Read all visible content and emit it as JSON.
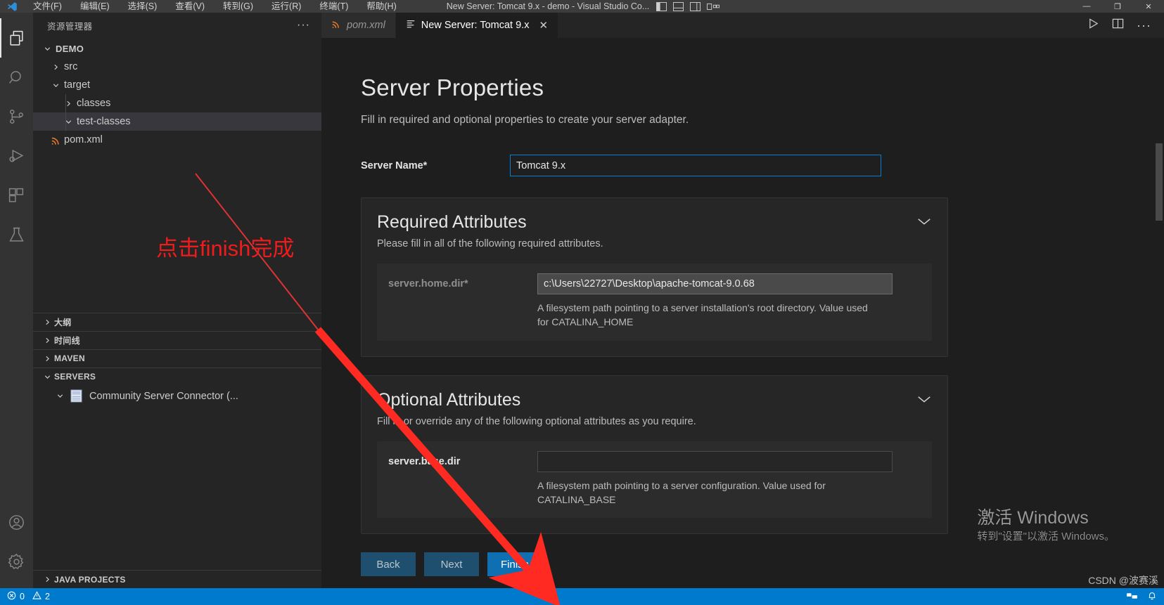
{
  "titlebar": {
    "menus": [
      "文件(F)",
      "编辑(E)",
      "选择(S)",
      "查看(V)",
      "转到(G)",
      "运行(R)",
      "终端(T)",
      "帮助(H)"
    ],
    "window_title": "New Server: Tomcat 9.x - demo - Visual Studio Co...",
    "layout_icons": [
      "panel-left-icon",
      "panel-bottom-icon",
      "panel-right-icon",
      "customize-layout-icon"
    ],
    "window_controls": [
      "minimize-icon",
      "maximize-icon",
      "close-icon"
    ]
  },
  "activitybar": {
    "items": [
      {
        "name": "explorer-icon",
        "active": true
      },
      {
        "name": "search-icon",
        "active": false
      },
      {
        "name": "source-control-icon",
        "active": false
      },
      {
        "name": "run-and-debug-icon",
        "active": false
      },
      {
        "name": "extensions-icon",
        "active": false
      },
      {
        "name": "testing-icon",
        "active": false
      }
    ],
    "bottom_items": [
      {
        "name": "accounts-icon"
      },
      {
        "name": "settings-gear-icon"
      }
    ]
  },
  "sidebar": {
    "title": "资源管理器",
    "more_actions": "···",
    "tree": [
      {
        "label": "DEMO",
        "level": 0,
        "expanded": true,
        "icon": "chevron-down-icon",
        "root": true,
        "selected": false
      },
      {
        "label": "src",
        "level": 1,
        "expanded": false,
        "icon": "chevron-right-icon",
        "root": false,
        "selected": false
      },
      {
        "label": "target",
        "level": 1,
        "expanded": true,
        "icon": "chevron-down-icon",
        "root": false,
        "selected": false
      },
      {
        "label": "classes",
        "level": 2,
        "expanded": false,
        "icon": "chevron-right-icon",
        "root": false,
        "selected": false
      },
      {
        "label": "test-classes",
        "level": 2,
        "expanded": true,
        "icon": "chevron-down-icon",
        "root": false,
        "selected": true
      },
      {
        "label": "pom.xml",
        "level": 1,
        "expanded": null,
        "icon": "xml-file-icon",
        "root": false,
        "selected": false
      }
    ],
    "sections": [
      {
        "label": "大纲",
        "expanded": false,
        "icon": "chevron-right-icon"
      },
      {
        "label": "时间线",
        "expanded": false,
        "icon": "chevron-right-icon"
      },
      {
        "label": "MAVEN",
        "expanded": false,
        "icon": "chevron-right-icon"
      },
      {
        "label": "SERVERS",
        "expanded": true,
        "icon": "chevron-down-icon"
      }
    ],
    "servers": [
      {
        "label": "Community Server Connector  (...",
        "icon": "server-icon",
        "expanded": true
      }
    ],
    "bottom_section": {
      "label": "JAVA PROJECTS",
      "expanded": false,
      "icon": "chevron-right-icon"
    }
  },
  "tabs": [
    {
      "label": "pom.xml",
      "icon": "xml-file-icon",
      "active": false,
      "preview": true
    },
    {
      "label": "New Server: Tomcat 9.x",
      "icon": "lines-icon",
      "active": true,
      "preview": false,
      "close": "✕"
    }
  ],
  "editor_actions": [
    "run-icon",
    "split-editor-icon",
    "more-actions-icon"
  ],
  "form": {
    "title": "Server Properties",
    "subtitle": "Fill in required and optional properties to create your server adapter.",
    "server_name_label": "Server Name*",
    "server_name_value": "Tomcat 9.x",
    "required": {
      "heading": "Required Attributes",
      "description": "Please fill in all of the following required attributes.",
      "collapse_icon": "chevron-down-icon",
      "attribute": {
        "label": "server.home.dir*",
        "value": "c:\\Users\\22727\\Desktop\\apache-tomcat-9.0.68",
        "help": "A filesystem path pointing to a server installation's root directory. Value used for CATALINA_HOME"
      }
    },
    "optional": {
      "heading": "Optional Attributes",
      "description": "Fill in or override any of the following optional attributes as you require.",
      "collapse_icon": "chevron-down-icon",
      "attribute": {
        "label": "server.base.dir",
        "value": "",
        "help": "A filesystem path pointing to a server configuration. Value used for CATALINA_BASE"
      }
    },
    "buttons": {
      "back": "Back",
      "next": "Next",
      "finish": "Finish"
    }
  },
  "statusbar": {
    "errors": "0",
    "warnings": "2",
    "error_icon": "error-circle-icon",
    "warning_icon": "warning-triangle-icon"
  },
  "annotations": {
    "note": "点击finish完成",
    "note_color": "#f01c1c",
    "arrow_color": "#ff2a22"
  },
  "watermark": {
    "line1": "激活 Windows",
    "line2": "转到\"设置\"以激活 Windows。"
  },
  "credit": "CSDN @波赛溪",
  "colors": {
    "accent": "#007acc",
    "primary_button": "#0e6fb2",
    "secondary_button": "#1f4f6e",
    "input_focus_border": "#007fd4",
    "sidebar_bg": "#252526",
    "editor_bg": "#1e1e1e",
    "activitybar_bg": "#333333",
    "titlebar_bg": "#3c3c3c"
  }
}
